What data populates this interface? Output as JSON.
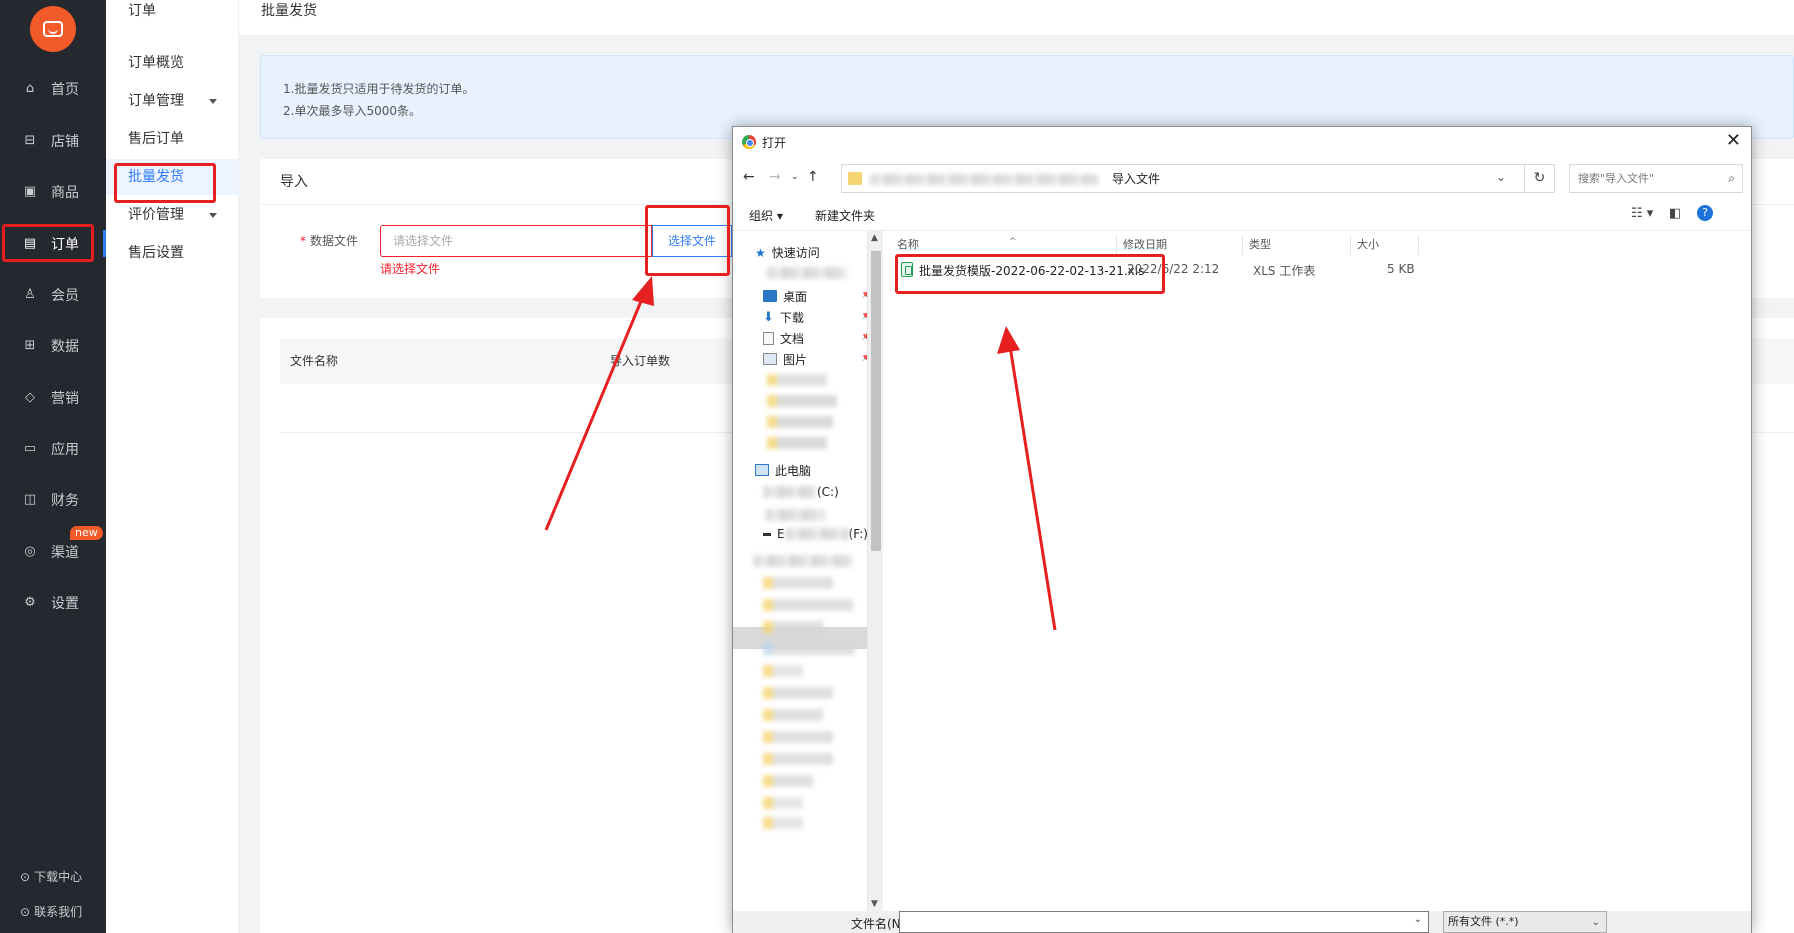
{
  "sidebar": {
    "items": [
      {
        "label": "首页",
        "icon": "home-icon"
      },
      {
        "label": "店铺",
        "icon": "shop-icon"
      },
      {
        "label": "商品",
        "icon": "goods-icon"
      },
      {
        "label": "订单",
        "icon": "order-icon"
      },
      {
        "label": "会员",
        "icon": "member-icon"
      },
      {
        "label": "数据",
        "icon": "data-icon"
      },
      {
        "label": "营销",
        "icon": "tag-icon"
      },
      {
        "label": "应用",
        "icon": "app-icon"
      },
      {
        "label": "财务",
        "icon": "finance-icon"
      },
      {
        "label": "渠道",
        "icon": "channel-icon"
      },
      {
        "label": "设置",
        "icon": "gear-icon"
      }
    ],
    "active_index": 3,
    "new_badge": "new",
    "download_center": "下载中心",
    "contact_us": "联系我们"
  },
  "subnav": {
    "title": "订单",
    "items": [
      {
        "label": "订单概览"
      },
      {
        "label": "订单管理"
      },
      {
        "label": "售后订单"
      },
      {
        "label": "批量发货"
      },
      {
        "label": "评价管理"
      },
      {
        "label": "售后设置"
      }
    ]
  },
  "main": {
    "page_title": "批量发货",
    "notice_lines": [
      "1.批量发货只适用于待发货的订单。",
      "2.单次最多导入5000条。"
    ],
    "import_card": {
      "title": "导入",
      "field_label": "数据文件",
      "required_mark": "*",
      "placeholder": "请选择文件",
      "choose_button": "选择文件",
      "error": "请选择文件"
    },
    "table": {
      "columns": [
        "文件名称",
        "导入订单数"
      ]
    }
  },
  "dialog": {
    "title": "打开",
    "address_text": "导入文件",
    "search_placeholder": "搜索\"导入文件\"",
    "organize": "组织 ▾",
    "new_folder": "新建文件夹",
    "quick_access": "快速访问",
    "pinned": [
      "桌面",
      "下载",
      "文档",
      "图片"
    ],
    "this_pc": "此电脑",
    "drive_c": "(C:)",
    "drive_f": "(F:)",
    "drive_f_prefix": "E",
    "columns": [
      "名称",
      "修改日期",
      "类型",
      "大小"
    ],
    "file": {
      "name": "批量发货模版-2022-06-22-02-13-21.xls",
      "date": "2022/6/22 2:12",
      "type": "XLS 工作表",
      "size": "5 KB"
    },
    "filename_label": "文件名(N):",
    "filetype_selected": "所有文件 (*.*)"
  }
}
